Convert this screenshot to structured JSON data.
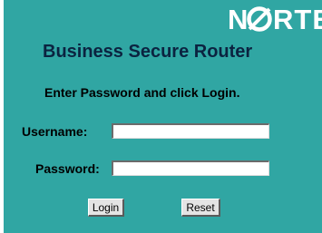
{
  "brand": {
    "logo_text": "NORTEL",
    "colors": {
      "logo": "#ffffff",
      "panel_background": "#30a6a3",
      "title": "#0b2340"
    }
  },
  "header": {
    "title": "Business Secure Router"
  },
  "form": {
    "instruction": "Enter Password and click Login.",
    "username_label": "Username:",
    "username_value": "",
    "password_label": "Password:",
    "password_value": "",
    "login_label": "Login",
    "reset_label": "Reset"
  }
}
